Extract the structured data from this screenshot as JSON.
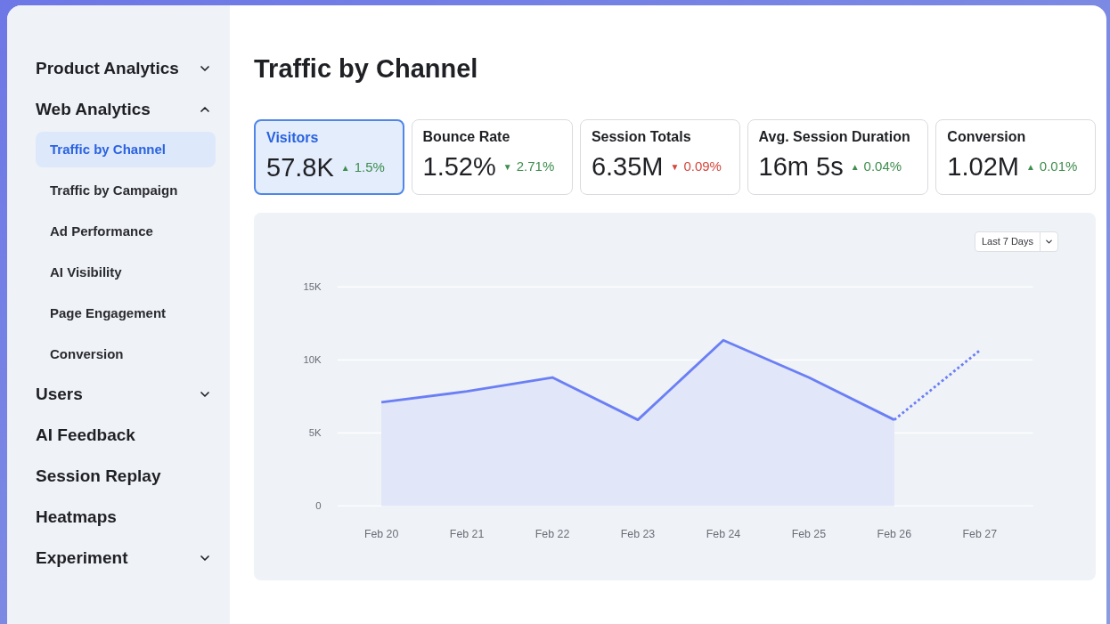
{
  "sidebar": {
    "items": [
      {
        "label": "Product Analytics",
        "kind": "group",
        "expanded": false
      },
      {
        "label": "Web Analytics",
        "kind": "group",
        "expanded": true,
        "children": [
          {
            "label": "Traffic by Channel",
            "selected": true
          },
          {
            "label": "Traffic by Campaign",
            "selected": false
          },
          {
            "label": "Ad Performance",
            "selected": false
          },
          {
            "label": "AI Visibility",
            "selected": false
          },
          {
            "label": "Page Engagement",
            "selected": false
          },
          {
            "label": "Conversion",
            "selected": false
          }
        ]
      },
      {
        "label": "Users",
        "kind": "group",
        "expanded": false
      },
      {
        "label": "AI Feedback",
        "kind": "link"
      },
      {
        "label": "Session Replay",
        "kind": "link"
      },
      {
        "label": "Heatmaps",
        "kind": "link"
      },
      {
        "label": "Experiment",
        "kind": "group",
        "expanded": false
      }
    ]
  },
  "page_title": "Traffic by Channel",
  "stats": [
    {
      "label": "Visitors",
      "value": "57.8K",
      "arrow": "▲",
      "change": "1.5%",
      "positive": true,
      "selected": true
    },
    {
      "label": "Bounce Rate",
      "value": "1.52%",
      "arrow": "▼",
      "change": "2.71%",
      "positive": true,
      "selected": false
    },
    {
      "label": "Session Totals",
      "value": "6.35M",
      "arrow": "▼",
      "change": "0.09%",
      "positive": false,
      "selected": false
    },
    {
      "label": "Avg. Session Duration",
      "value": "16m 5s",
      "arrow": "▲",
      "change": "0.04%",
      "positive": true,
      "selected": false
    },
    {
      "label": "Conversion",
      "value": "1.02M",
      "arrow": "▲",
      "change": "0.01%",
      "positive": true,
      "selected": false
    }
  ],
  "chart": {
    "range_select": "Last 7 Days",
    "chart_data": {
      "type": "area",
      "categories": [
        "Feb 20",
        "Feb 21",
        "Feb 22",
        "Feb 23",
        "Feb 24",
        "Feb 25",
        "Feb 26",
        "Feb 27"
      ],
      "ylim": [
        0,
        15000
      ],
      "yticks": [
        {
          "value": 0,
          "label": "0"
        },
        {
          "value": 5000,
          "label": "5K"
        },
        {
          "value": 10000,
          "label": "10K"
        },
        {
          "value": 15000,
          "label": "15K"
        }
      ],
      "series": [
        {
          "type": "area",
          "line_style": "solid",
          "color": "#6b7ff5",
          "values": [
            7100,
            7850,
            8800,
            5900,
            11350,
            8800,
            5900,
            null
          ]
        },
        {
          "type": "line",
          "line_style": "dotted",
          "color": "#6b7ff5",
          "values": [
            null,
            null,
            null,
            null,
            null,
            null,
            5900,
            10650
          ]
        }
      ]
    }
  }
}
